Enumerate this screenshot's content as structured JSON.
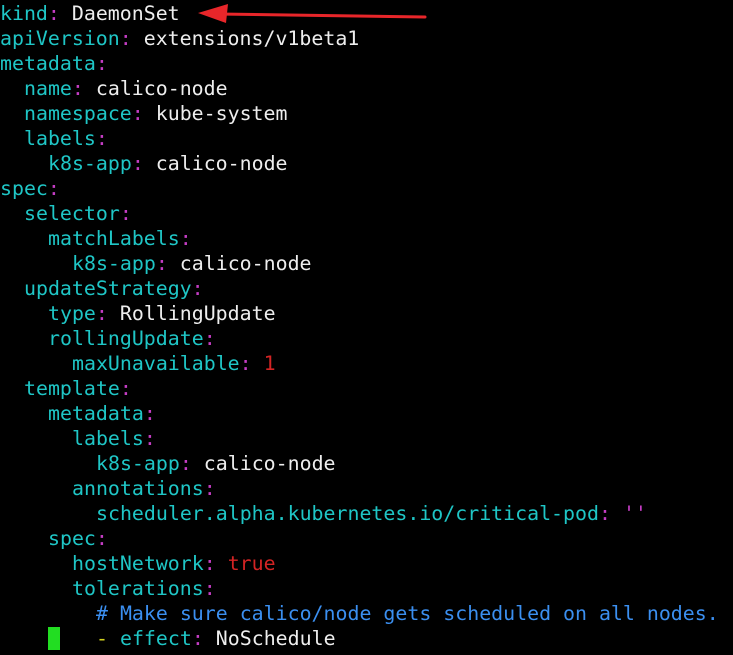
{
  "lines": [
    {
      "indent": 0,
      "key": "kind",
      "value": "DaemonSet",
      "value_type": "val"
    },
    {
      "indent": 0,
      "key": "apiVersion",
      "value": "extensions/v1beta1",
      "value_type": "val"
    },
    {
      "indent": 0,
      "key": "metadata",
      "value": "",
      "value_type": "val"
    },
    {
      "indent": 1,
      "key": "name",
      "value": "calico-node",
      "value_type": "val"
    },
    {
      "indent": 1,
      "key": "namespace",
      "value": "kube-system",
      "value_type": "val"
    },
    {
      "indent": 1,
      "key": "labels",
      "value": "",
      "value_type": "val"
    },
    {
      "indent": 2,
      "key": "k8s-app",
      "value": "calico-node",
      "value_type": "val"
    },
    {
      "indent": 0,
      "key": "spec",
      "value": "",
      "value_type": "val"
    },
    {
      "indent": 1,
      "key": "selector",
      "value": "",
      "value_type": "val"
    },
    {
      "indent": 2,
      "key": "matchLabels",
      "value": "",
      "value_type": "val"
    },
    {
      "indent": 3,
      "key": "k8s-app",
      "value": "calico-node",
      "value_type": "val"
    },
    {
      "indent": 1,
      "key": "updateStrategy",
      "value": "",
      "value_type": "val"
    },
    {
      "indent": 2,
      "key": "type",
      "value": "RollingUpdate",
      "value_type": "val"
    },
    {
      "indent": 2,
      "key": "rollingUpdate",
      "value": "",
      "value_type": "val"
    },
    {
      "indent": 3,
      "key": "maxUnavailable",
      "value": "1",
      "value_type": "num"
    },
    {
      "indent": 1,
      "key": "template",
      "value": "",
      "value_type": "val"
    },
    {
      "indent": 2,
      "key": "metadata",
      "value": "",
      "value_type": "val"
    },
    {
      "indent": 3,
      "key": "labels",
      "value": "",
      "value_type": "val"
    },
    {
      "indent": 4,
      "key": "k8s-app",
      "value": "calico-node",
      "value_type": "val"
    },
    {
      "indent": 3,
      "key": "annotations",
      "value": "",
      "value_type": "val"
    },
    {
      "indent": 4,
      "key": "scheduler.alpha.kubernetes.io/critical-pod",
      "value": "''",
      "value_type": "str"
    },
    {
      "indent": 2,
      "key": "spec",
      "value": "",
      "value_type": "val"
    },
    {
      "indent": 3,
      "key": "hostNetwork",
      "value": "true",
      "value_type": "bool"
    },
    {
      "indent": 3,
      "key": "tolerations",
      "value": "",
      "value_type": "val"
    },
    {
      "indent": 4,
      "comment": "# Make sure calico/node gets scheduled on all nodes."
    },
    {
      "indent": 4,
      "dash": "-",
      "key": "effect",
      "value": "NoSchedule",
      "value_type": "val"
    }
  ],
  "colors": {
    "background": "#000000",
    "key": "#1fc6c6",
    "colon": "#c43dc4",
    "value": "#eeeeee",
    "number": "#d42424",
    "comment": "#3b8ff0",
    "dash": "#d2d21f",
    "cursor": "#22dd22",
    "arrow": "#e8262a"
  },
  "annotation": {
    "icon": "red-arrow-icon",
    "points_to": "kind"
  }
}
